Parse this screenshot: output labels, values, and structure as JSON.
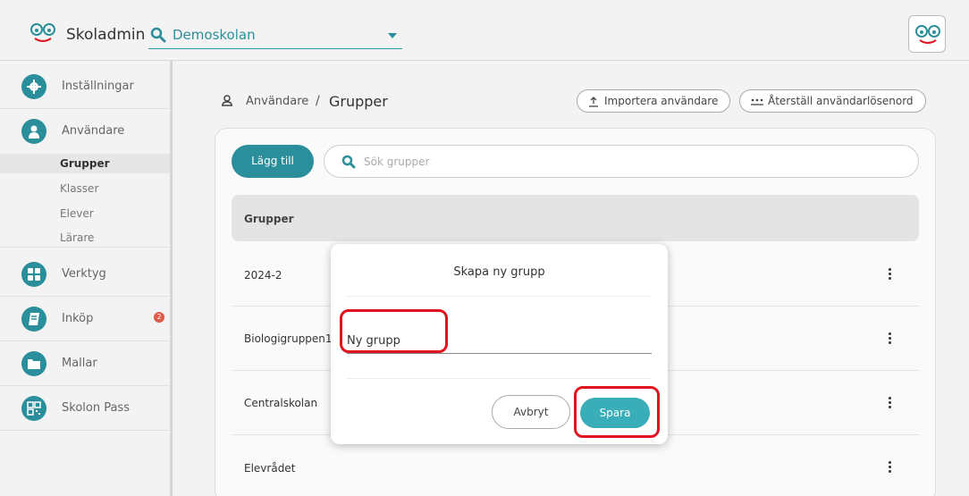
{
  "app": {
    "title": "Skoladmin",
    "school": "Demoskolan"
  },
  "sidebar": {
    "items": [
      {
        "label": "Inställningar",
        "icon": "gear-icon"
      },
      {
        "label": "Användare",
        "icon": "user-icon"
      },
      {
        "label": "Verktyg",
        "icon": "grid-icon"
      },
      {
        "label": "Inköp",
        "icon": "book-icon",
        "badge": "2"
      },
      {
        "label": "Mallar",
        "icon": "folder-icon"
      },
      {
        "label": "Skolon Pass",
        "icon": "qr-icon"
      }
    ],
    "subitems": [
      {
        "label": "Grupper",
        "active": true
      },
      {
        "label": "Klasser"
      },
      {
        "label": "Elever"
      },
      {
        "label": "Lärare"
      }
    ]
  },
  "breadcrumb": {
    "parent": "Användare",
    "separator": "/",
    "current": "Grupper"
  },
  "header_buttons": {
    "import": "Importera användare",
    "reset": "Återställ användarlösenord"
  },
  "toolbar": {
    "add_label": "Lägg till",
    "search_placeholder": "Sök grupper"
  },
  "table": {
    "header": "Grupper",
    "rows": [
      "2024-2",
      "Biologigruppen1",
      "Centralskolan",
      "Elevrådet"
    ]
  },
  "modal": {
    "title": "Skapa ny grupp",
    "input_value": "Ny grupp",
    "cancel_label": "Avbryt",
    "save_label": "Spara"
  },
  "colors": {
    "accent": "#2a8f9a",
    "save": "#3aaeb8",
    "highlight": "#e0141e",
    "badge": "#e05a4a"
  }
}
